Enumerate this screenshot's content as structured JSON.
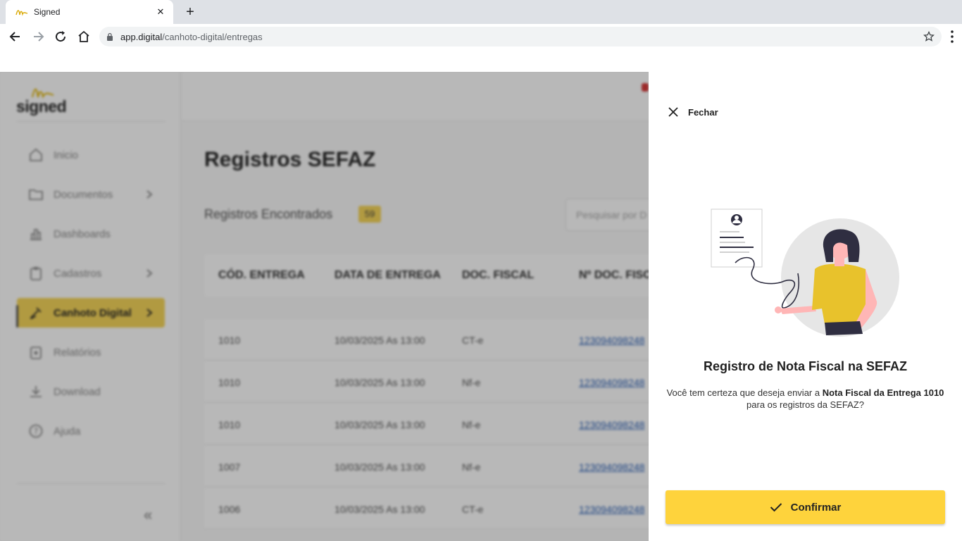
{
  "browser": {
    "tab_title": "Signed",
    "url_host": "app.digital",
    "url_path": "/canhoto-digital/entregas"
  },
  "app": {
    "logo_text": "signed",
    "sidebar": {
      "items": [
        {
          "label": "Inicio",
          "icon": "home-icon",
          "has_chevron": false
        },
        {
          "label": "Documentos",
          "icon": "folder-icon",
          "has_chevron": true
        },
        {
          "label": "Dashboards",
          "icon": "chart-icon",
          "has_chevron": false
        },
        {
          "label": "Cadastros",
          "icon": "clipboard-icon",
          "has_chevron": true
        },
        {
          "label": "Canhoto Digital",
          "icon": "sign-icon",
          "has_chevron": true,
          "active": true
        },
        {
          "label": "Relatórios",
          "icon": "report-icon",
          "has_chevron": false
        },
        {
          "label": "Download",
          "icon": "download-icon",
          "has_chevron": false
        },
        {
          "label": "Ajuda",
          "icon": "help-icon",
          "has_chevron": false
        }
      ],
      "collapse_label": "«"
    },
    "page_title": "Registros SEFAZ",
    "found_label": "Registros Encontrados",
    "found_count": "59",
    "search_placeholder": "Pesquisar por D",
    "table": {
      "headers": [
        "CÓD. ENTREGA",
        "DATA DE ENTREGA",
        "DOC. FISCAL",
        "Nº DOC. FISC"
      ],
      "rows": [
        [
          "1010",
          "10/03/2025 As 13:00",
          "CT-e",
          "123094098248"
        ],
        [
          "1010",
          "10/03/2025 As 13:00",
          "Nf-e",
          "123094098248"
        ],
        [
          "1010",
          "10/03/2025 As 13:00",
          "Nf-e",
          "123094098248"
        ],
        [
          "1007",
          "10/03/2025 As 13:00",
          "Nf-e",
          "123094098248"
        ],
        [
          "1006",
          "10/03/2025 As 13:00",
          "CT-e",
          "123094098248"
        ]
      ]
    },
    "colors": {
      "accent": "#f6d65b",
      "confirm": "#fed33c"
    }
  },
  "drawer": {
    "close_label": "Fechar",
    "title": "Registro de Nota Fiscal na SEFAZ",
    "text_before": "Você tem certeza que deseja enviar a ",
    "text_bold": "Nota Fiscal da Entrega 1010",
    "text_after": " para os registros da SEFAZ?",
    "confirm_label": "Confirmar"
  }
}
